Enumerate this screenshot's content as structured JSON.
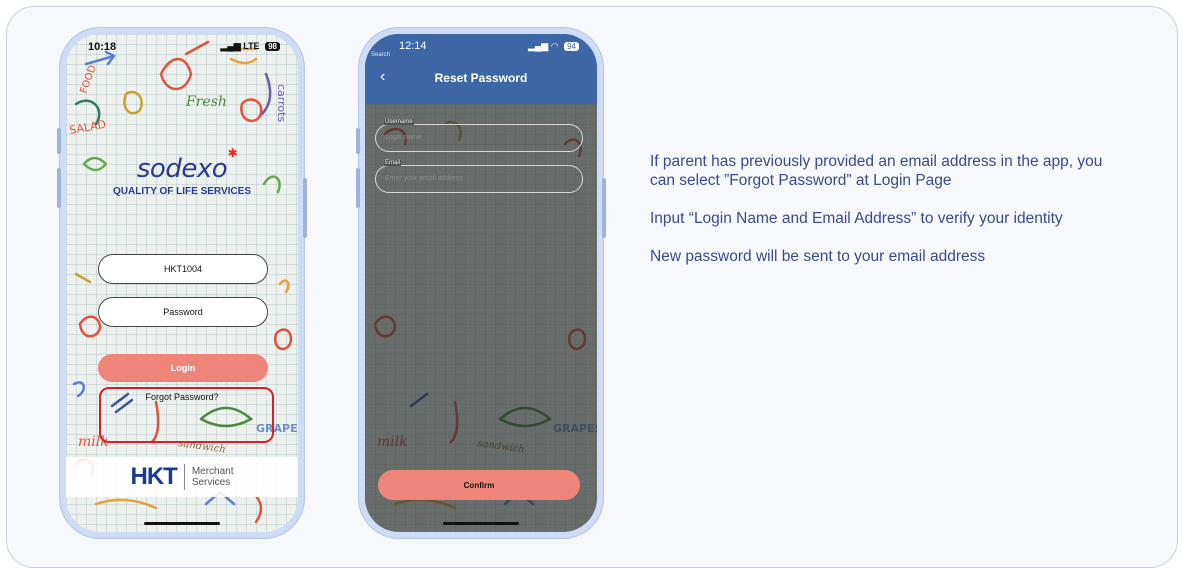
{
  "login_screen": {
    "status": {
      "time": "10:18",
      "signal": "LTE",
      "battery": "98"
    },
    "logo": {
      "wordmark": "sodexo",
      "tagline": "QUALITY OF LIFE SERVICES"
    },
    "login_name_value": "HKT1004",
    "password_placeholder": "Password",
    "login_button": "Login",
    "forgot_password_link": "Forgot Password?",
    "merchant_brand": "HKT",
    "merchant_text_line1": "Merchant",
    "merchant_text_line2": "Services",
    "doodle_words": {
      "food": "FOOD",
      "fresh": "Fresh",
      "salad": "SALAD",
      "grapes": "GRAPES",
      "milk": "milk",
      "sandwich": "sandwich",
      "carrots": "carrots"
    }
  },
  "reset_screen": {
    "status": {
      "time": "12:14",
      "back_app": "Search",
      "battery": "94"
    },
    "title": "Reset Password",
    "username_label": "Username",
    "username_placeholder": "Login name",
    "email_label": "Email",
    "email_placeholder": "Enter your email address",
    "confirm_button": "Confirm",
    "doodle_words": {
      "grapes": "GRAPES",
      "milk": "milk",
      "sandwich": "sandwich"
    }
  },
  "instructions": [
    "If parent has previously provided an email address in the app, you can select ”Forgot Password” at Login Page",
    "Input “Login Name and Email Address” to verify your identity",
    "New password will be sent to your email address"
  ],
  "colors": {
    "accent_salmon": "#ef857a",
    "header_blue": "#3d66a5",
    "highlight_red": "#d51f2a",
    "text_navy": "#3a4a8a"
  }
}
